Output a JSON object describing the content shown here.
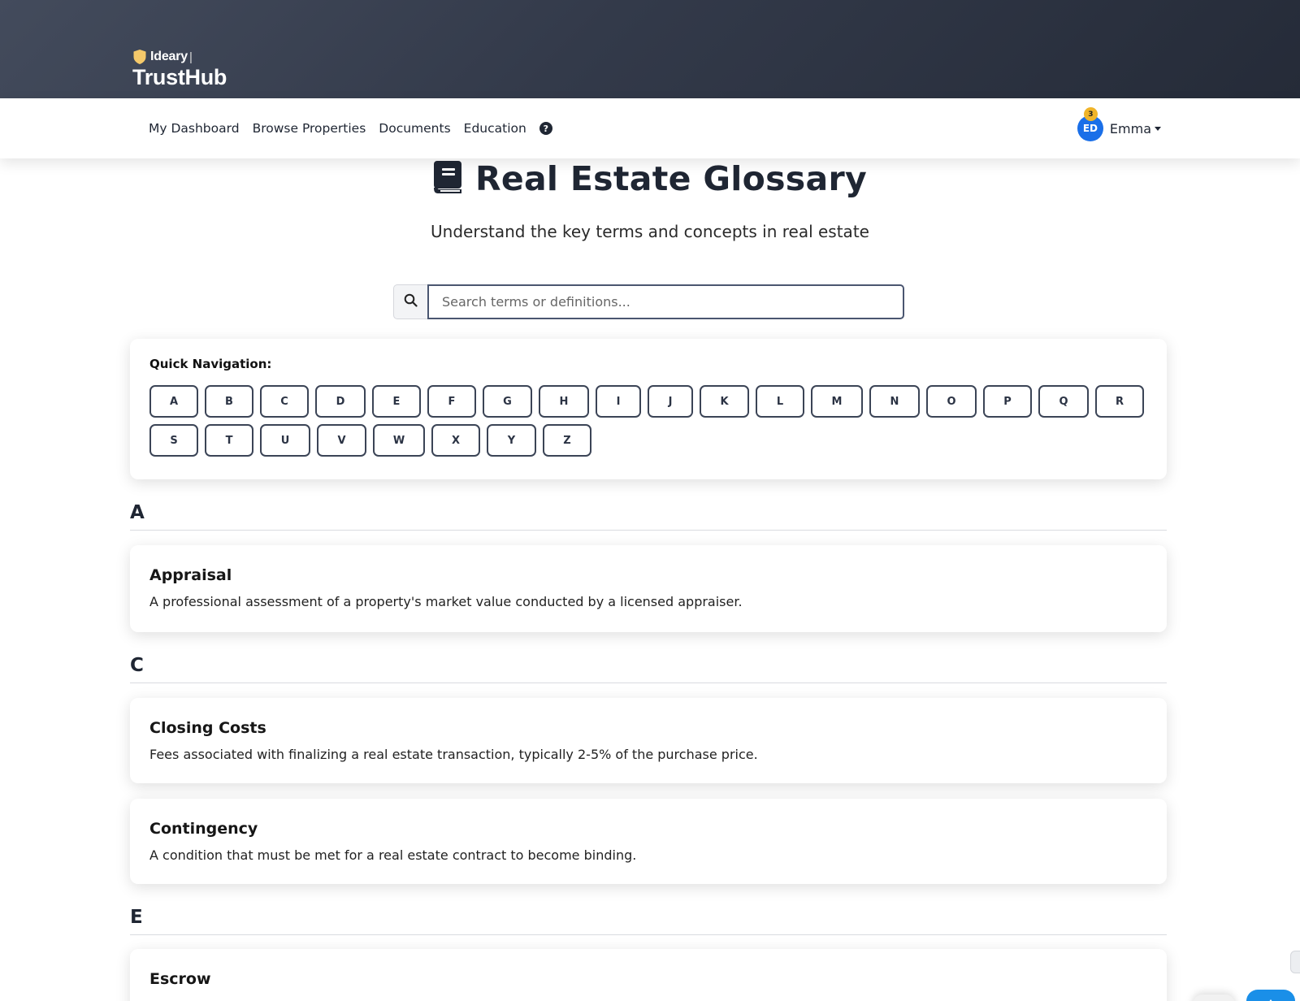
{
  "brand": {
    "top": "Ideary",
    "separator": "|",
    "name": "TrustHub"
  },
  "nav": {
    "links": [
      "My Dashboard",
      "Browse Properties",
      "Documents",
      "Education"
    ],
    "help_icon": "?"
  },
  "user": {
    "initials": "ED",
    "name": "Emma",
    "notifications": "3"
  },
  "page": {
    "title": "Real Estate Glossary",
    "subtitle": "Understand the key terms and concepts in real estate"
  },
  "search": {
    "placeholder": "Search terms or definitions..."
  },
  "quicknav": {
    "label": "Quick Navigation:",
    "letters": [
      "A",
      "B",
      "C",
      "D",
      "E",
      "F",
      "G",
      "H",
      "I",
      "J",
      "K",
      "L",
      "M",
      "N",
      "O",
      "P",
      "Q",
      "R",
      "S",
      "T",
      "U",
      "V",
      "W",
      "X",
      "Y",
      "Z"
    ]
  },
  "sections": [
    {
      "letter": "A",
      "terms": [
        {
          "name": "Appraisal",
          "definition": "A professional assessment of a property's market value conducted by a licensed appraiser."
        }
      ]
    },
    {
      "letter": "C",
      "terms": [
        {
          "name": "Closing Costs",
          "definition": "Fees associated with finalizing a real estate transaction, typically 2-5% of the purchase price."
        },
        {
          "name": "Contingency",
          "definition": "A condition that must be met for a real estate contract to become binding."
        }
      ]
    },
    {
      "letter": "E",
      "terms": [
        {
          "name": "Escrow",
          "definition": ""
        }
      ]
    }
  ],
  "colors": {
    "banner": "#333a4a",
    "text_dark": "#1f2633",
    "avatar": "#1a6fe8",
    "badge": "#f0b429",
    "logo_shield": "#f5c96a"
  },
  "icons": [
    "shield-icon",
    "help-icon",
    "caret-down-icon",
    "book-icon",
    "search-icon",
    "arrow-up-icon"
  ]
}
